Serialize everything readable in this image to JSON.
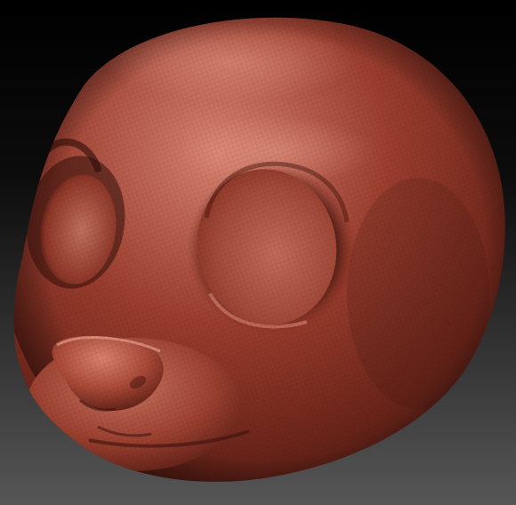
{
  "scene": {
    "subject": "sculpted-head-model",
    "colors": {
      "background_top": "#000000",
      "background_bottom": "#565656",
      "clay_base": "#9a3d2e",
      "clay_highlight": "#d78270",
      "clay_shadow": "#3a1510"
    }
  }
}
